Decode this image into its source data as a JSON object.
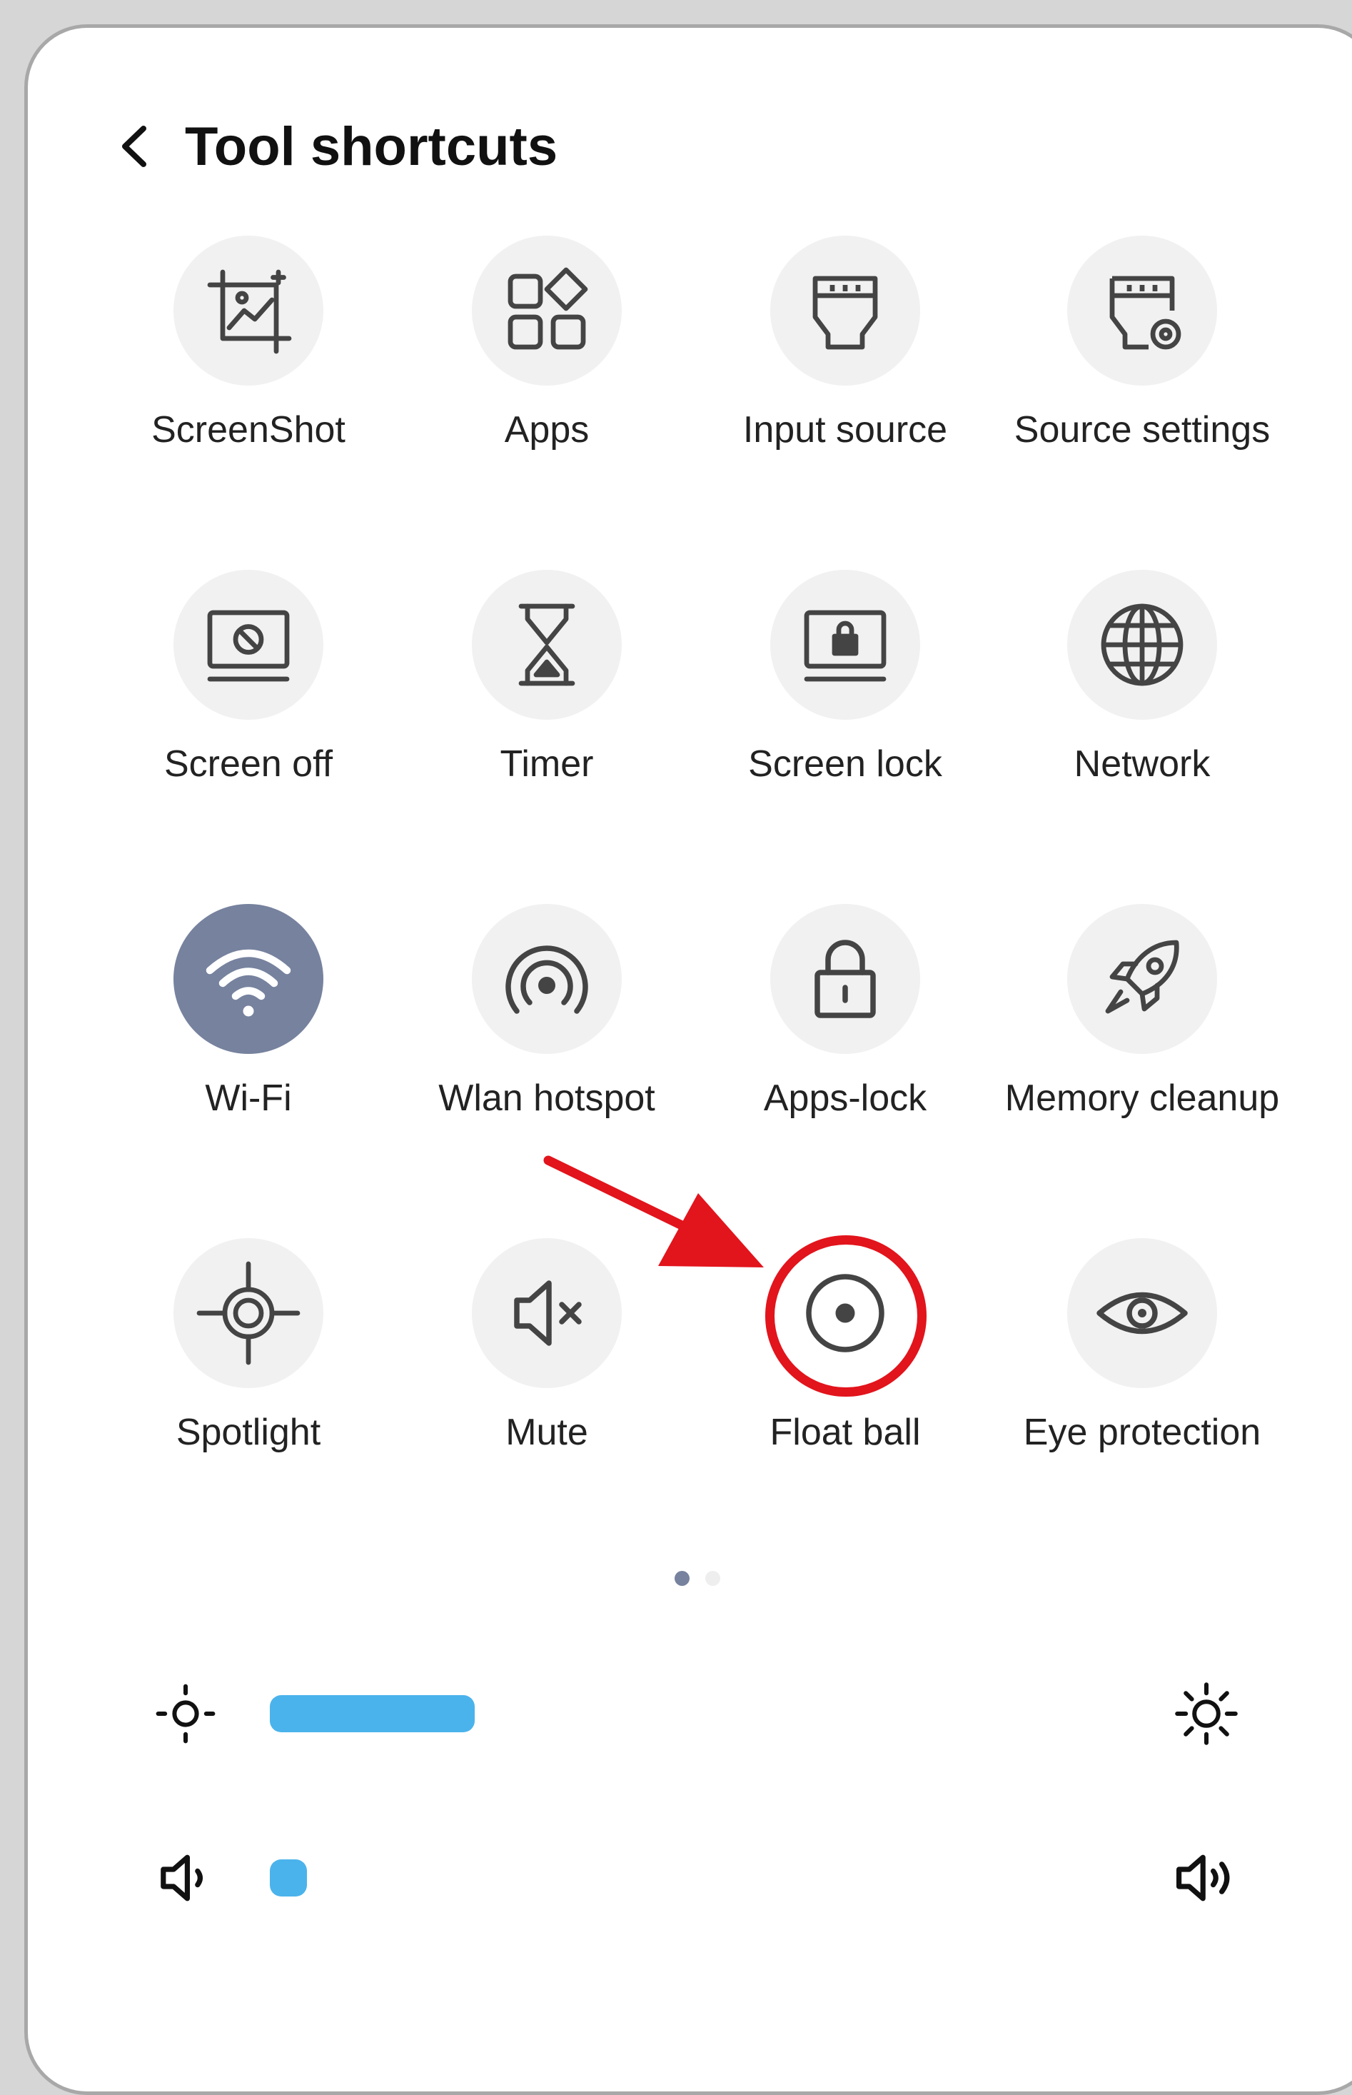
{
  "header": {
    "title": "Tool shortcuts"
  },
  "tiles": [
    {
      "label": "ScreenShot",
      "icon": "screenshot-icon"
    },
    {
      "label": "Apps",
      "icon": "apps-icon"
    },
    {
      "label": "Input source",
      "icon": "input-source-icon"
    },
    {
      "label": "Source settings",
      "icon": "source-settings-icon"
    },
    {
      "label": "Screen off",
      "icon": "screen-off-icon"
    },
    {
      "label": "Timer",
      "icon": "hourglass-icon"
    },
    {
      "label": "Screen lock",
      "icon": "screen-lock-icon"
    },
    {
      "label": "Network",
      "icon": "globe-icon"
    },
    {
      "label": "Wi-Fi",
      "icon": "wifi-icon",
      "active": true
    },
    {
      "label": "Wlan hotspot",
      "icon": "hotspot-icon"
    },
    {
      "label": "Apps-lock",
      "icon": "padlock-icon"
    },
    {
      "label": "Memory cleanup",
      "icon": "rocket-icon"
    },
    {
      "label": "Spotlight",
      "icon": "crosshair-icon"
    },
    {
      "label": "Mute",
      "icon": "mute-icon"
    },
    {
      "label": "Float ball",
      "icon": "float-ball-icon"
    },
    {
      "label": "Eye protection",
      "icon": "eye-icon"
    }
  ],
  "pager": {
    "page_count": 2,
    "current_page": 1
  },
  "brightness": {
    "icon_low": "brightness-low-icon",
    "icon_high": "brightness-high-icon",
    "level": 0.24
  },
  "volume": {
    "icon_low": "volume-low-icon",
    "icon_high": "volume-high-icon",
    "level": 0.03
  },
  "colors": {
    "accent": "#4bb3ec",
    "active_tile": "#76829e",
    "tile_bg": "#f1f1f1",
    "annotation": "#e2141c"
  },
  "annotation": {
    "highlighted_tile": "Float ball"
  }
}
